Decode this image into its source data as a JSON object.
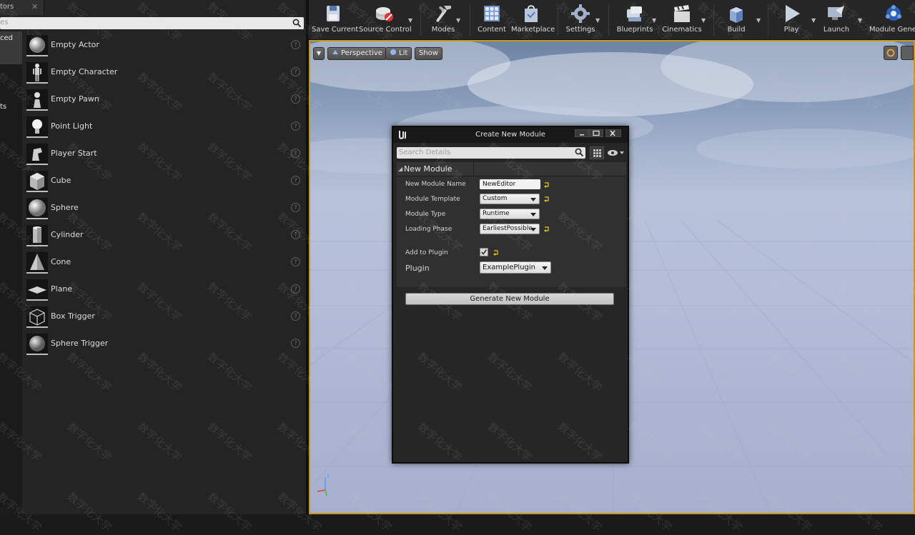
{
  "left_panel": {
    "tab_label": "tors",
    "search_placeholder": "es",
    "categories": [
      {
        "label": "ced",
        "active": true
      },
      {
        "label": "ts",
        "active": false
      }
    ],
    "items": [
      {
        "label": "Empty Actor",
        "icon": "sphere-icon"
      },
      {
        "label": "Empty Character",
        "icon": "character-icon"
      },
      {
        "label": "Empty Pawn",
        "icon": "pawn-icon"
      },
      {
        "label": "Point Light",
        "icon": "lightbulb-icon"
      },
      {
        "label": "Player Start",
        "icon": "player-start-icon"
      },
      {
        "label": "Cube",
        "icon": "cube-icon"
      },
      {
        "label": "Sphere",
        "icon": "sphere-icon"
      },
      {
        "label": "Cylinder",
        "icon": "cylinder-icon"
      },
      {
        "label": "Cone",
        "icon": "cone-icon"
      },
      {
        "label": "Plane",
        "icon": "plane-icon"
      },
      {
        "label": "Box Trigger",
        "icon": "box-trigger-icon"
      },
      {
        "label": "Sphere Trigger",
        "icon": "sphere-trigger-icon"
      }
    ]
  },
  "toolbar": {
    "buttons": [
      {
        "label": "Save Current",
        "icon": "save-icon"
      },
      {
        "label": "Source Control",
        "icon": "source-control-icon"
      },
      {
        "label": "Modes",
        "icon": "modes-icon"
      },
      {
        "label": "Content",
        "icon": "content-icon"
      },
      {
        "label": "Marketplace",
        "icon": "marketplace-icon"
      },
      {
        "label": "Settings",
        "icon": "settings-icon"
      },
      {
        "label": "Blueprints",
        "icon": "blueprints-icon"
      },
      {
        "label": "Cinematics",
        "icon": "cinematics-icon"
      },
      {
        "label": "Build",
        "icon": "build-icon"
      },
      {
        "label": "Play",
        "icon": "play-icon"
      },
      {
        "label": "Launch",
        "icon": "launch-icon"
      },
      {
        "label": "Module Genera",
        "icon": "module-generator-icon"
      }
    ]
  },
  "viewport": {
    "perspective_label": "Perspective",
    "lit_label": "Lit",
    "show_label": "Show",
    "frame_color": "#c79a16"
  },
  "dialog": {
    "title": "Create New Module",
    "search_placeholder": "Search Details",
    "section_label": "New Module",
    "fields": {
      "module_name_label": "New Module Name",
      "module_name_value": "NewEditor",
      "module_template_label": "Module Template",
      "module_template_value": "Custom",
      "module_type_label": "Module Type",
      "module_type_value": "Runtime",
      "loading_phase_label": "Loading Phase",
      "loading_phase_value": "EarliestPossible",
      "add_to_plugin_label": "Add to Plugin",
      "add_to_plugin_checked": true,
      "plugin_label": "Plugin",
      "plugin_value": "ExamplePlugin"
    },
    "generate_label": "Generate New Module"
  },
  "watermark_text": "数字化大学"
}
